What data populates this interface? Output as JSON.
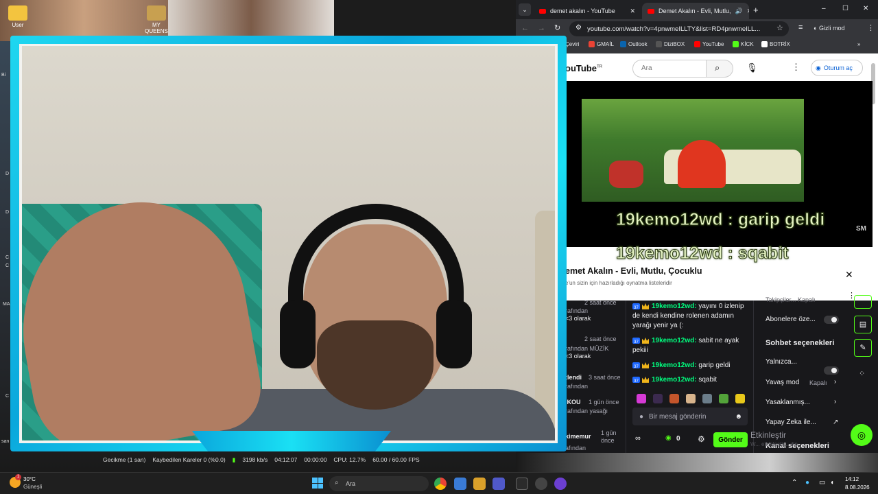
{
  "desktop": {
    "icons": [
      {
        "label": "User"
      },
      {
        "label": "MY QUEENS"
      }
    ],
    "side_fragments": [
      "Bi",
      "D",
      "D",
      "C",
      "C",
      "MA",
      "C",
      "san"
    ]
  },
  "browser": {
    "tabs": [
      {
        "title": "demet akalın - YouTube"
      },
      {
        "title": "Demet Akalın - Evli, Mutlu,"
      }
    ],
    "new_tab": "+",
    "window_controls": {
      "minimize": "–",
      "maximize": "☐",
      "close": "✕"
    },
    "url": "youtube.com/watch?v=4pnwmeILLTY&list=RD4pnwmeILL...",
    "incognito_label": "Gizli mod",
    "bookmarks": [
      {
        "label": "Çeviri",
        "color": "#4285f4"
      },
      {
        "label": "GMAİL",
        "color": "#ea4335"
      },
      {
        "label": "Outlook",
        "color": "#0a64ad"
      },
      {
        "label": "DiziBOX",
        "color": "#222222"
      },
      {
        "label": "YouTube",
        "color": "#ff0000"
      },
      {
        "label": "KİCK",
        "color": "#53fc18"
      },
      {
        "label": "BOTRİX",
        "color": "#ffffff"
      }
    ],
    "more_bookmarks": "»"
  },
  "youtube": {
    "logo_text": "ouTube",
    "logo_sup": "TR",
    "search_placeholder": "Ara",
    "signin_label": "Oturum aç",
    "overlay_chat": [
      {
        "text": "19kemo12wd : garip geldi"
      },
      {
        "text": "19kemo12wd : sqabit"
      }
    ],
    "video_watermark": "SM",
    "playlist_title": "emet Akalın - Evli, Mutlu, Çocuklu",
    "playlist_subtitle": "e'un sizin için hazırladığı oynatma listeleridir",
    "playlist_close": "✕"
  },
  "kick": {
    "side_events": [
      {
        "time": "2 saat önce",
        "line1": "rafından",
        "line2": "<3 olarak"
      },
      {
        "time": "2 saat önce",
        "line1": "rafından MÜZİK",
        "line2": "<3 olarak"
      },
      {
        "name": "tlendi",
        "time": "3 saat önce",
        "line1": "rafından",
        "line2": ""
      },
      {
        "name": "IKOU",
        "time": "1 gün önce",
        "line1": "rafından yasağı",
        "line2": ""
      },
      {
        "name": "kimemur",
        "time": "1 gün önce",
        "line1": "afından",
        "line2": ""
      }
    ],
    "chat": [
      {
        "badge": "37",
        "user": "19kemo12wd:",
        "text": "yayını 0 izlenip de kendi kendine rolenen adamın yarağı yenir ya (:"
      },
      {
        "badge": "37",
        "user": "19kemo12wd:",
        "text": "sabit ne ayak pekiii"
      },
      {
        "badge": "37",
        "user": "19kemo12wd:",
        "text": "garip geldi"
      },
      {
        "badge": "37",
        "user": "19kemo12wd:",
        "text": "sqabit"
      }
    ],
    "message_placeholder": "Bir mesaj gönderin",
    "viewer_count": "0",
    "send_label": "Gönder",
    "settings": {
      "top_faded": "Takipçiler... Kapalı",
      "subscribers": "Abonelere öze...",
      "section_title": "Sohbet seçenekleri",
      "only": "Yalnızca...",
      "slow_mode": "Yavaş mod",
      "slow_value": "Kapalı",
      "banned": "Yasaklanmış...",
      "ai": "Yapay Zeka ile...",
      "channel": "Kanal seçenekleri"
    },
    "activate_windows": "Etkinleştir",
    "activate_faded": "W... etkinleştir... din."
  },
  "obs": {
    "status": [
      "Gecikme (1 san)",
      "Kaybedilen Kareler 0 (%0.0)",
      "3198 kb/s",
      "04:12:07",
      "00:00:00",
      "CPU: 12.7%",
      "60.00 / 60.00 FPS"
    ]
  },
  "taskbar": {
    "weather_temp": "30°C",
    "weather_desc": "Güneşli",
    "notification_count": "1",
    "search_placeholder": "Ara",
    "time": "14:12",
    "date": "8.08.2026"
  }
}
